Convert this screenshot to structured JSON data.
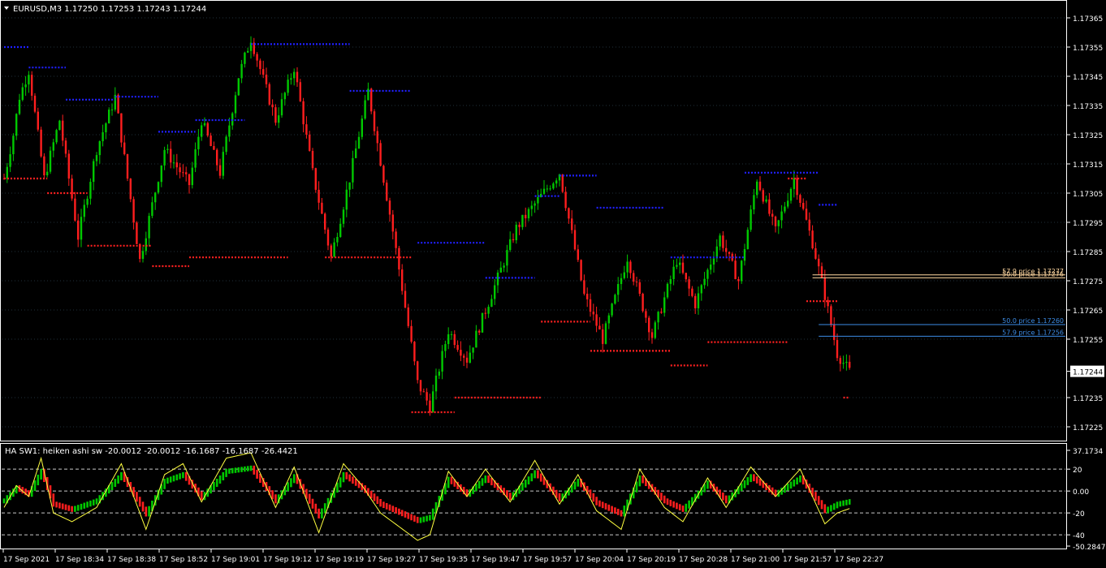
{
  "colors": {
    "background": "#000000",
    "frame": "#FFFFFF",
    "grid": "#20303a",
    "bull": "#00C800",
    "bear": "#FF1E1E",
    "swing_high": "#2020FF",
    "swing_low": "#FF2020",
    "fib_orange": "#FFD7A0",
    "fib_blue": "#3C8CE6",
    "osc_line": "#FFFF40",
    "text": "#FFFFFF"
  },
  "main": {
    "header": "EURUSD,M3  1.17250 1.17253 1.17243 1.17244",
    "header_arrow_icon": "triangle-down-icon",
    "y_ticks": [
      "1.17365",
      "1.17355",
      "1.17345",
      "1.17335",
      "1.17325",
      "1.17315",
      "1.17305",
      "1.17295",
      "1.17285",
      "1.17275",
      "1.17265",
      "1.17255",
      "1.17244",
      "1.17235",
      "1.17225"
    ],
    "current_price": "1.17244",
    "fib_labels": [
      {
        "text": "57.9 price 1.17277",
        "price": 1.17277,
        "color": "#FFD7A0"
      },
      {
        "text": "50.0 price 1.17276",
        "price": 1.17276,
        "color": "#FFD7A0"
      },
      {
        "text": "50.0 price 1.17260",
        "price": 1.1726,
        "color": "#3C8CE6"
      },
      {
        "text": "57.9 price 1.17256",
        "price": 1.17256,
        "color": "#3C8CE6"
      }
    ]
  },
  "sub": {
    "header": "HA SW1: heiken ashi sw -20.0012 -20.0012 -16.1687 -16.1687 -26.4421",
    "y_ticks": [
      "37.1734",
      "20",
      "0.00",
      "-20",
      "-40",
      "-50.2847"
    ],
    "range": [
      -50.2847,
      37.1734
    ],
    "levels": [
      20,
      0,
      -20,
      -40
    ]
  },
  "x_ticks": [
    "17 Sep 2021",
    "17 Sep 18:34",
    "17 Sep 18:38",
    "17 Sep 18:52",
    "17 Sep 19:01",
    "17 Sep 19:12",
    "17 Sep 19:19",
    "17 Sep 19:27",
    "17 Sep 19:35",
    "17 Sep 19:47",
    "17 Sep 19:57",
    "17 Sep 20:04",
    "17 Sep 20:19",
    "17 Sep 20:28",
    "17 Sep 21:00",
    "17 Sep 21:57",
    "17 Sep 22:27"
  ],
  "chart_data": {
    "type": "candlestick",
    "title": "EURUSD,M3",
    "price_range": [
      1.1722,
      1.1737
    ],
    "close_path": [
      [
        0,
        1.1731
      ],
      [
        3,
        1.17325
      ],
      [
        5,
        1.17338
      ],
      [
        8,
        1.17347
      ],
      [
        13,
        1.1731
      ],
      [
        18,
        1.1733
      ],
      [
        24,
        1.1729
      ],
      [
        30,
        1.1732
      ],
      [
        36,
        1.17338
      ],
      [
        44,
        1.17282
      ],
      [
        52,
        1.1732
      ],
      [
        60,
        1.17308
      ],
      [
        64,
        1.1733
      ],
      [
        70,
        1.17312
      ],
      [
        76,
        1.17345
      ],
      [
        80,
        1.17358
      ],
      [
        88,
        1.1733
      ],
      [
        94,
        1.17348
      ],
      [
        100,
        1.17312
      ],
      [
        106,
        1.17283
      ],
      [
        112,
        1.1731
      ],
      [
        118,
        1.1734
      ],
      [
        126,
        1.17292
      ],
      [
        134,
        1.1724
      ],
      [
        138,
        1.17232
      ],
      [
        144,
        1.17258
      ],
      [
        150,
        1.17248
      ],
      [
        160,
        1.17276
      ],
      [
        166,
        1.17293
      ],
      [
        174,
        1.17304
      ],
      [
        180,
        1.17312
      ],
      [
        188,
        1.1727
      ],
      [
        194,
        1.17255
      ],
      [
        202,
        1.17283
      ],
      [
        210,
        1.17256
      ],
      [
        218,
        1.17282
      ],
      [
        224,
        1.17267
      ],
      [
        232,
        1.1729
      ],
      [
        238,
        1.17275
      ],
      [
        244,
        1.1731
      ],
      [
        250,
        1.17292
      ],
      [
        256,
        1.1731
      ],
      [
        262,
        1.17288
      ],
      [
        266,
        1.1727
      ],
      [
        270,
        1.1725
      ],
      [
        274,
        1.17244
      ]
    ],
    "swing_highs": [
      {
        "price": 1.17355,
        "x0": 0,
        "x1": 8
      },
      {
        "price": 1.17348,
        "x0": 8,
        "x1": 20
      },
      {
        "price": 1.17337,
        "x0": 20,
        "x1": 36
      },
      {
        "price": 1.17338,
        "x0": 36,
        "x1": 50
      },
      {
        "price": 1.17326,
        "x0": 50,
        "x1": 62
      },
      {
        "price": 1.1733,
        "x0": 62,
        "x1": 78
      },
      {
        "price": 1.17356,
        "x0": 80,
        "x1": 112
      },
      {
        "price": 1.1734,
        "x0": 112,
        "x1": 132
      },
      {
        "price": 1.17288,
        "x0": 134,
        "x1": 156
      },
      {
        "price": 1.17276,
        "x0": 156,
        "x1": 172
      },
      {
        "price": 1.17304,
        "x0": 172,
        "x1": 180
      },
      {
        "price": 1.17311,
        "x0": 180,
        "x1": 192
      },
      {
        "price": 1.173,
        "x0": 192,
        "x1": 214
      },
      {
        "price": 1.17283,
        "x0": 216,
        "x1": 240
      },
      {
        "price": 1.17312,
        "x0": 240,
        "x1": 264
      },
      {
        "price": 1.17301,
        "x0": 264,
        "x1": 270
      }
    ],
    "swing_lows": [
      {
        "price": 1.1731,
        "x0": 0,
        "x1": 14
      },
      {
        "price": 1.17305,
        "x0": 14,
        "x1": 27
      },
      {
        "price": 1.17287,
        "x0": 27,
        "x1": 48
      },
      {
        "price": 1.1728,
        "x0": 48,
        "x1": 60
      },
      {
        "price": 1.17283,
        "x0": 60,
        "x1": 92
      },
      {
        "price": 1.17283,
        "x0": 104,
        "x1": 132
      },
      {
        "price": 1.1723,
        "x0": 132,
        "x1": 146
      },
      {
        "price": 1.17235,
        "x0": 146,
        "x1": 174
      },
      {
        "price": 1.17261,
        "x0": 174,
        "x1": 190
      },
      {
        "price": 1.17251,
        "x0": 190,
        "x1": 216
      },
      {
        "price": 1.17246,
        "x0": 216,
        "x1": 228
      },
      {
        "price": 1.17254,
        "x0": 228,
        "x1": 254
      },
      {
        "price": 1.1731,
        "x0": 254,
        "x1": 260
      },
      {
        "price": 1.17268,
        "x0": 260,
        "x1": 270
      },
      {
        "price": 1.17235,
        "x0": 272,
        "x1": 274
      }
    ],
    "oscillator": {
      "name": "heiken ashi sw",
      "values": [
        -20.0012,
        -20.0012,
        -16.1687,
        -16.1687,
        -26.4421
      ],
      "line_path": [
        [
          0,
          -15
        ],
        [
          4,
          5
        ],
        [
          8,
          -5
        ],
        [
          12,
          30
        ],
        [
          16,
          -20
        ],
        [
          22,
          -28
        ],
        [
          30,
          -15
        ],
        [
          38,
          25
        ],
        [
          46,
          -35
        ],
        [
          52,
          15
        ],
        [
          58,
          25
        ],
        [
          64,
          -10
        ],
        [
          72,
          30
        ],
        [
          80,
          35
        ],
        [
          88,
          -15
        ],
        [
          94,
          22
        ],
        [
          102,
          -38
        ],
        [
          110,
          25
        ],
        [
          116,
          5
        ],
        [
          122,
          -20
        ],
        [
          134,
          -45
        ],
        [
          138,
          -40
        ],
        [
          144,
          18
        ],
        [
          150,
          -5
        ],
        [
          156,
          20
        ],
        [
          164,
          -10
        ],
        [
          172,
          28
        ],
        [
          180,
          -12
        ],
        [
          186,
          15
        ],
        [
          192,
          -18
        ],
        [
          200,
          -35
        ],
        [
          206,
          20
        ],
        [
          214,
          -15
        ],
        [
          220,
          -28
        ],
        [
          228,
          12
        ],
        [
          234,
          -15
        ],
        [
          242,
          22
        ],
        [
          250,
          -5
        ],
        [
          258,
          20
        ],
        [
          266,
          -30
        ],
        [
          270,
          -20
        ],
        [
          274,
          -16
        ]
      ]
    }
  }
}
